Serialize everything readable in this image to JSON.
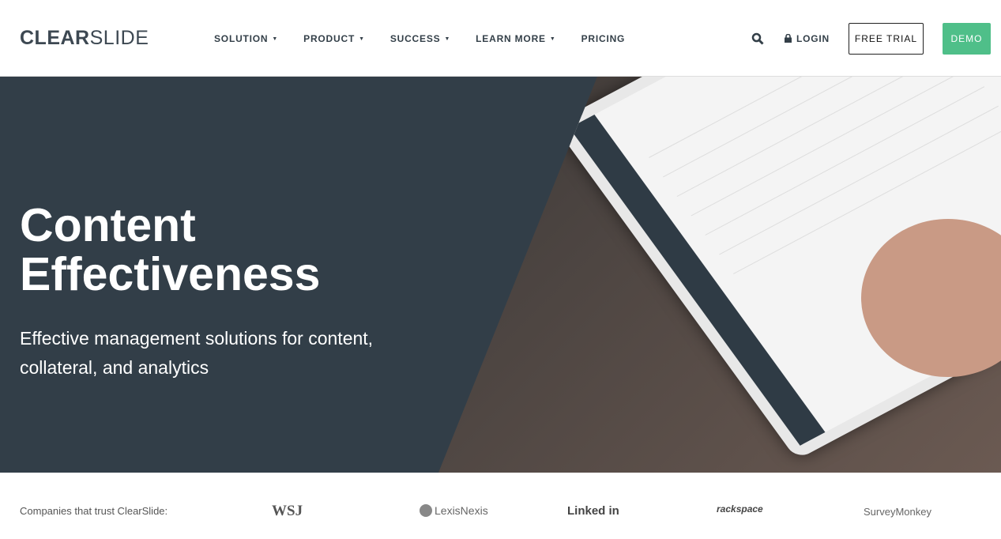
{
  "header": {
    "logo_bold": "CLEAR",
    "logo_light": "SLIDE",
    "nav": [
      {
        "label": "SOLUTION",
        "dropdown": true
      },
      {
        "label": "PRODUCT",
        "dropdown": true
      },
      {
        "label": "SUCCESS",
        "dropdown": true
      },
      {
        "label": "LEARN MORE",
        "dropdown": true
      },
      {
        "label": "PRICING",
        "dropdown": false
      }
    ],
    "caret": "▼",
    "login": "LOGIN",
    "free_trial": "FREE TRIAL",
    "demo": "DEMO",
    "accent": "#4fbf89"
  },
  "hero": {
    "title_line1": "Content",
    "title_line2": "Effectiveness",
    "subtitle": "Effective management solutions for content, collateral, and analytics",
    "background": "#323e48"
  },
  "trust": {
    "label": "Companies that trust ClearSlide:",
    "logos": [
      "WSJ",
      "LexisNexis",
      "Linked in",
      "rackspace",
      "SurveyMonkey"
    ]
  }
}
